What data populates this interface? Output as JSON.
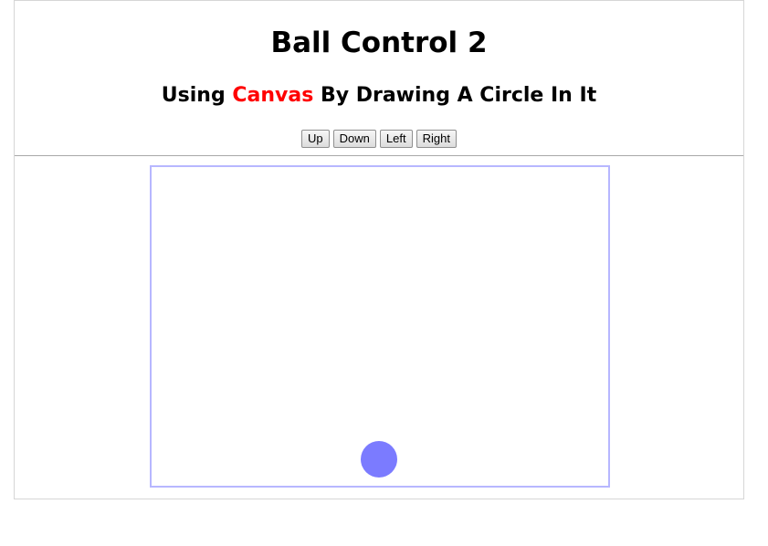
{
  "header": {
    "title": "Ball Control 2",
    "subtitle_prefix": "Using ",
    "subtitle_accent": "Canvas",
    "subtitle_suffix": " By Drawing A Circle In It"
  },
  "controls": {
    "up_label": "Up",
    "down_label": "Down",
    "left_label": "Left",
    "right_label": "Right"
  },
  "canvas": {
    "ball_color": "#7b7bff",
    "accent_color": "#ff0000"
  }
}
